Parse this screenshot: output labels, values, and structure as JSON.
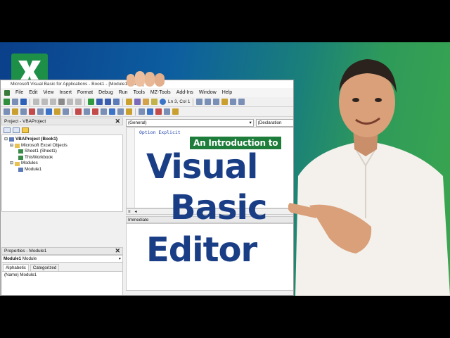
{
  "logo": {
    "letter": "X",
    "color": "#1d8f46"
  },
  "window": {
    "title": "Microsoft Visual Basic for Applications - Book1 - [Module1 (Code)]",
    "menu": [
      "File",
      "Edit",
      "View",
      "Insert",
      "Format",
      "Debug",
      "Run",
      "Tools",
      "MZ-Tools",
      "Add-Ins",
      "Window",
      "Help"
    ],
    "cursor_position": "Ln 3, Col 1"
  },
  "project_pane": {
    "title": "Project - VBAProject",
    "tree": [
      {
        "label": "VBAProject (Book1)",
        "level": 0
      },
      {
        "label": "Microsoft Excel Objects",
        "level": 1
      },
      {
        "label": "Sheet1 (Sheet1)",
        "level": 2
      },
      {
        "label": "ThisWorkbook",
        "level": 2
      },
      {
        "label": "Modules",
        "level": 1
      },
      {
        "label": "Module1",
        "level": 2
      }
    ]
  },
  "properties_pane": {
    "title": "Properties - Module1",
    "object_name": "Module1",
    "object_type": "Module",
    "tabs": [
      "Alphabetic",
      "Categorized"
    ],
    "row": {
      "name": "(Name)",
      "value": "Module1"
    }
  },
  "code_window": {
    "object_combo": "(General)",
    "proc_combo": "(Declaration",
    "code_line": "Option Explicit",
    "immediate_title": "Immediate"
  },
  "overlay": {
    "subtitle": "An Introduction to",
    "line1": "Visual",
    "line2": "Basic",
    "line3": "Editor",
    "subtitle_color": "#1e7d3b",
    "title_color": "#1a3e86"
  }
}
